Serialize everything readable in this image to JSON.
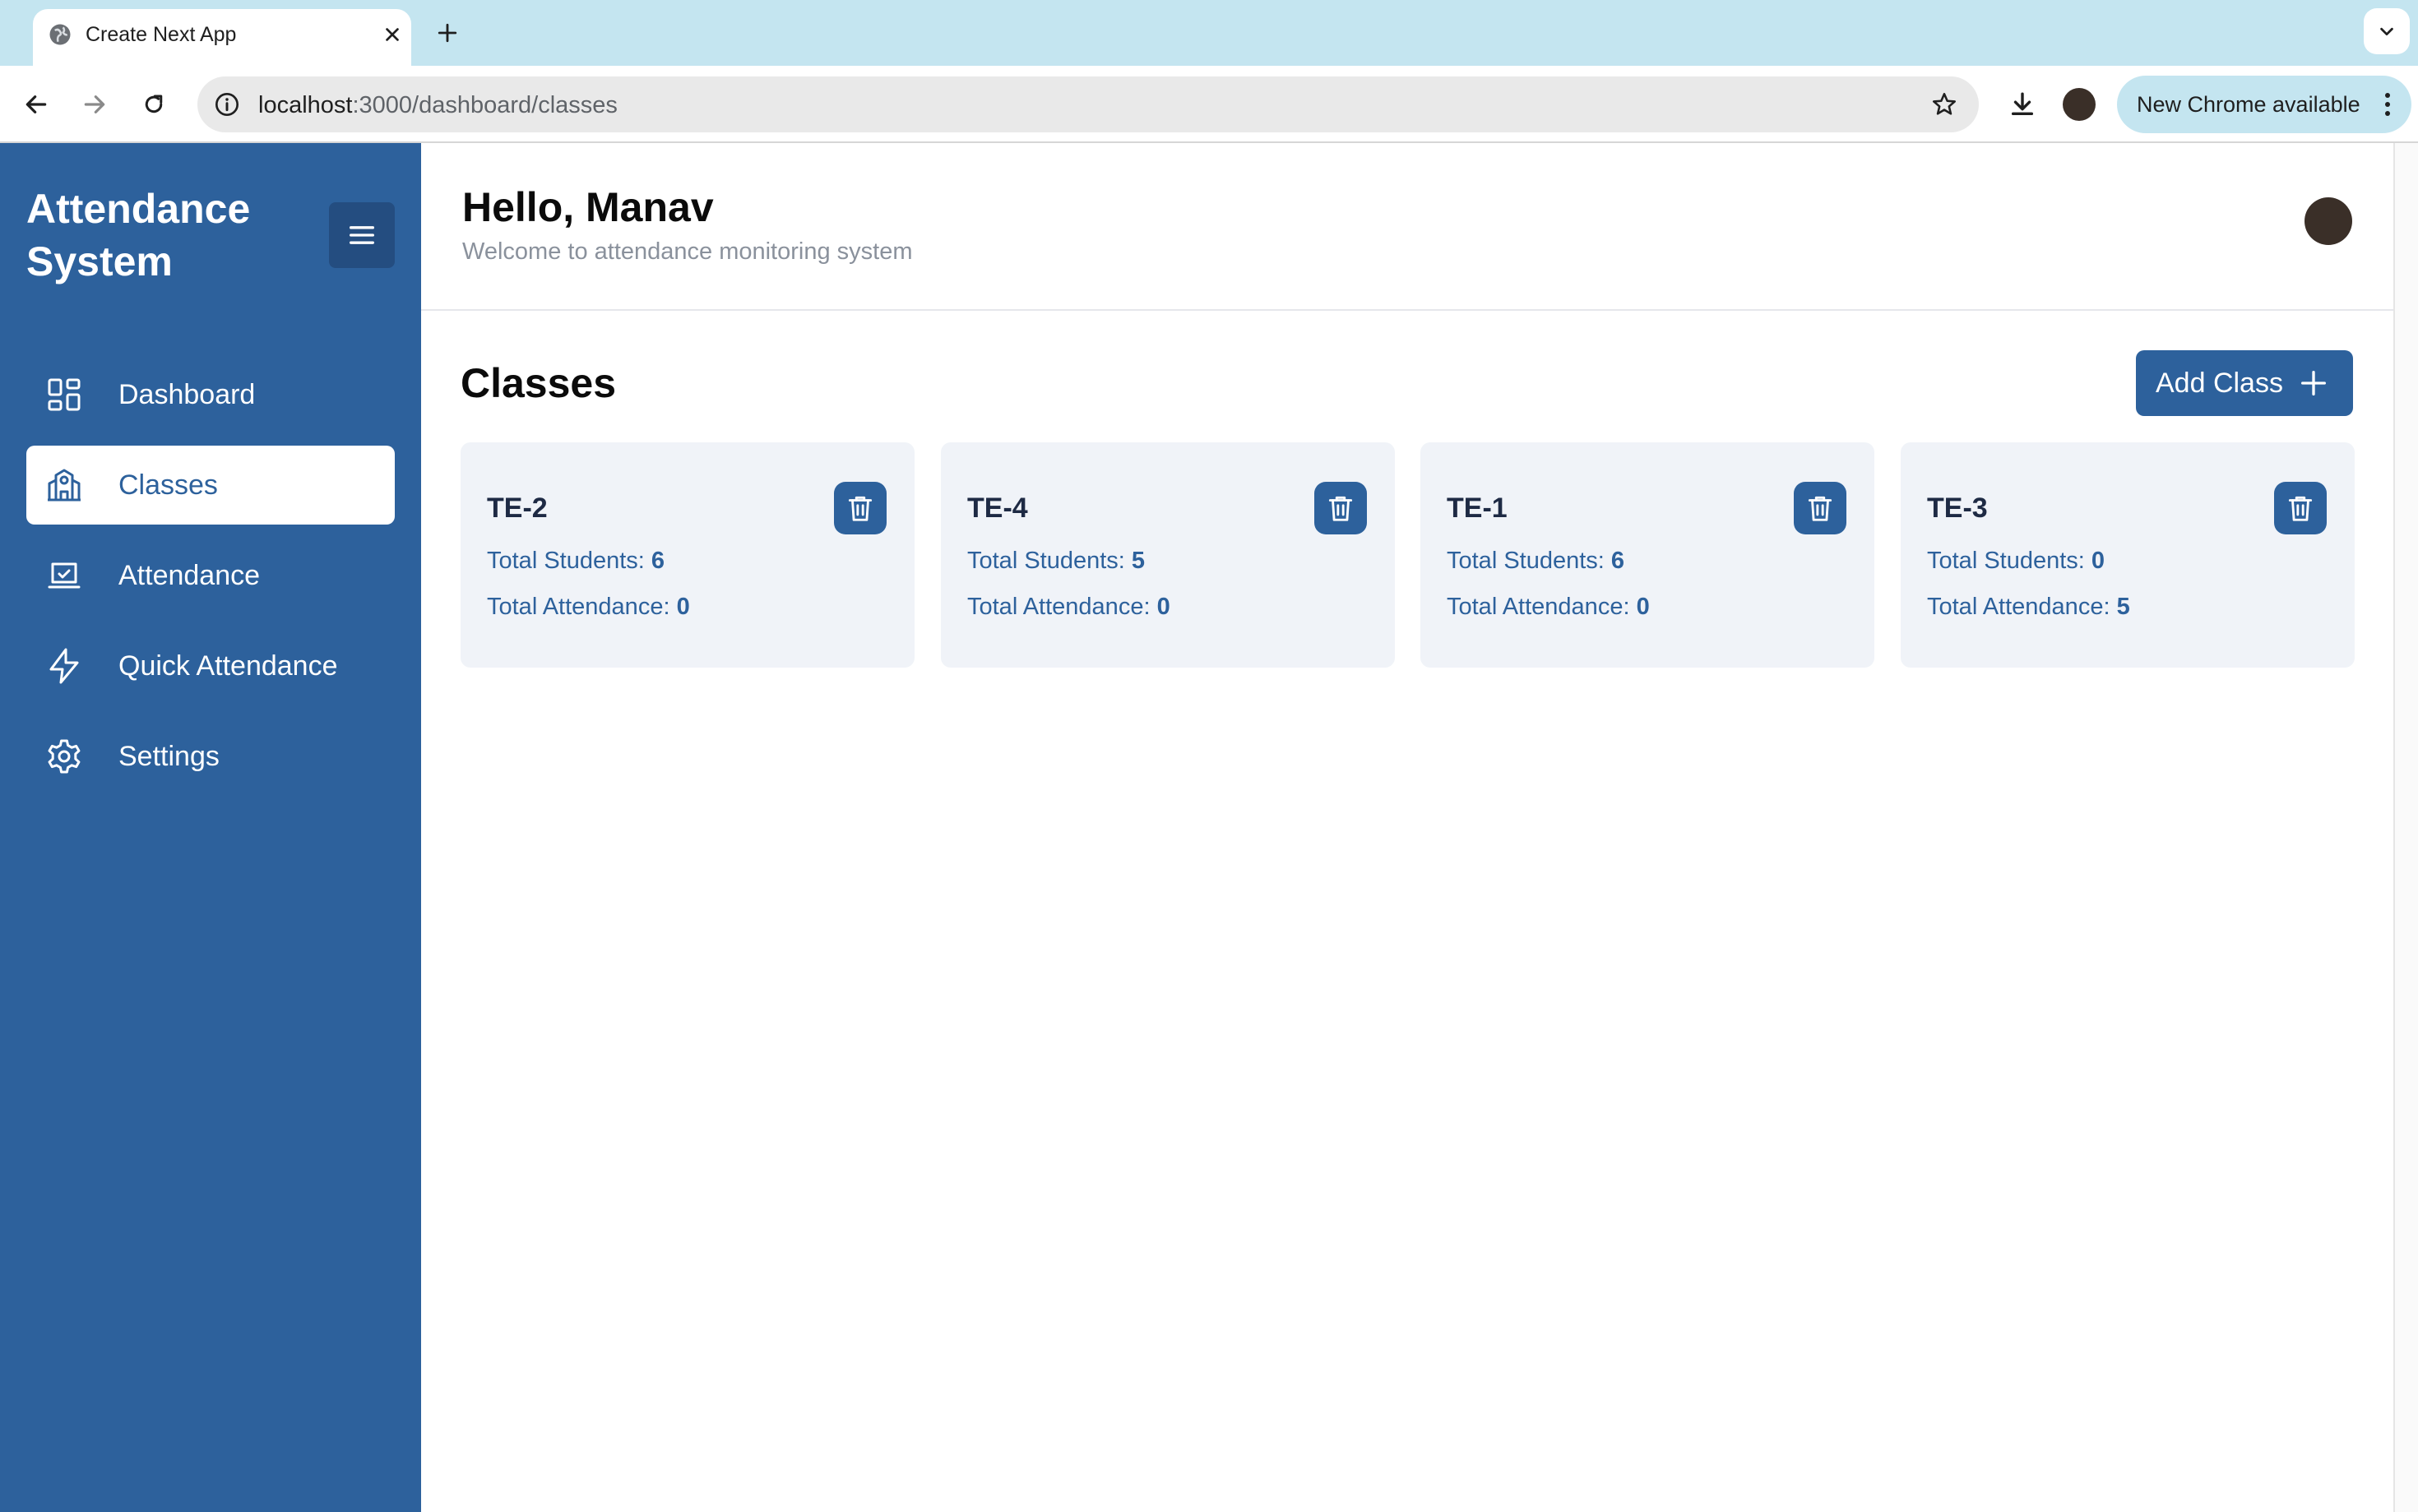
{
  "browser": {
    "tab_title": "Create Next App",
    "url_host": "localhost",
    "url_path": ":3000/dashboard/classes",
    "update_label": "New Chrome available"
  },
  "sidebar": {
    "app_title": "Attendance System",
    "items": [
      {
        "label": "Dashboard",
        "icon": "dashboard-grid-icon",
        "active": false
      },
      {
        "label": "Classes",
        "icon": "school-building-icon",
        "active": true
      },
      {
        "label": "Attendance",
        "icon": "laptop-check-icon",
        "active": false
      },
      {
        "label": "Quick Attendance",
        "icon": "lightning-bolt-icon",
        "active": false
      },
      {
        "label": "Settings",
        "icon": "gear-icon",
        "active": false
      }
    ]
  },
  "header": {
    "greeting": "Hello, Manav",
    "subtitle": "Welcome to attendance monitoring system"
  },
  "main": {
    "section_title": "Classes",
    "add_button_label": "Add Class",
    "students_label": "Total Students: ",
    "attendance_label": "Total Attendance: ",
    "classes": [
      {
        "name": "TE-2",
        "total_students": "6",
        "total_attendance": "0"
      },
      {
        "name": "TE-4",
        "total_students": "5",
        "total_attendance": "0"
      },
      {
        "name": "TE-1",
        "total_students": "6",
        "total_attendance": "0"
      },
      {
        "name": "TE-3",
        "total_students": "0",
        "total_attendance": "5"
      }
    ]
  },
  "colors": {
    "primary": "#2d619c",
    "sidebar_bg": "#2d619c",
    "card_bg": "#f0f3f8",
    "chrome_accent": "#c4e5f0"
  }
}
